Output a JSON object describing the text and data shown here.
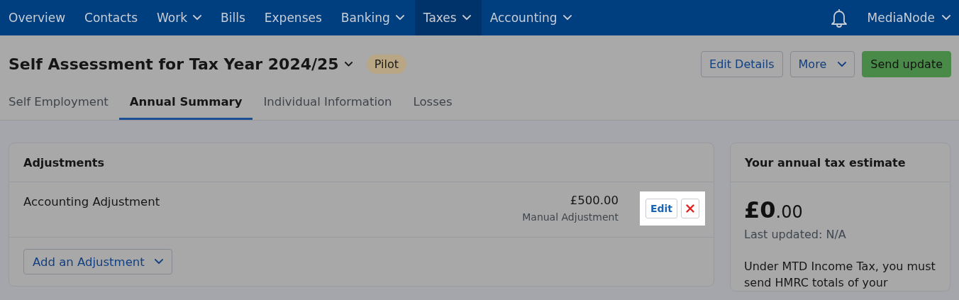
{
  "nav": {
    "items": [
      {
        "label": "Overview",
        "dropdown": false,
        "selected": false
      },
      {
        "label": "Contacts",
        "dropdown": false,
        "selected": false
      },
      {
        "label": "Work",
        "dropdown": true,
        "selected": false
      },
      {
        "label": "Bills",
        "dropdown": false,
        "selected": false
      },
      {
        "label": "Expenses",
        "dropdown": false,
        "selected": false
      },
      {
        "label": "Banking",
        "dropdown": true,
        "selected": false
      },
      {
        "label": "Taxes",
        "dropdown": true,
        "selected": true
      },
      {
        "label": "Accounting",
        "dropdown": true,
        "selected": false
      }
    ],
    "account": "MediaNode"
  },
  "header": {
    "title": "Self Assessment for Tax Year 2024/25",
    "badge": "Pilot",
    "buttons": [
      {
        "label": "Edit Details",
        "kind": "outline"
      },
      {
        "label": "More",
        "kind": "menu"
      },
      {
        "label": "Send update",
        "kind": "primary"
      }
    ]
  },
  "tabs": [
    {
      "label": "Self Employment",
      "selected": false
    },
    {
      "label": "Annual Summary",
      "selected": true
    },
    {
      "label": "Individual Information",
      "selected": false
    },
    {
      "label": "Losses",
      "selected": false
    }
  ],
  "adjustments": {
    "title": "Adjustments",
    "rows": [
      {
        "name": "Accounting Adjustment",
        "amount": "£500.00",
        "type": "Manual Adjustment",
        "edit": "Edit",
        "highlighted": true
      }
    ],
    "add_button": "Add an Adjustment"
  },
  "estimate": {
    "title": "Your annual tax estimate",
    "amount": {
      "whole": "£0",
      "fraction": ".00"
    },
    "updated": "Last updated: N/A",
    "text": "Under MTD Income Tax, you must send HMRC totals of your"
  }
}
